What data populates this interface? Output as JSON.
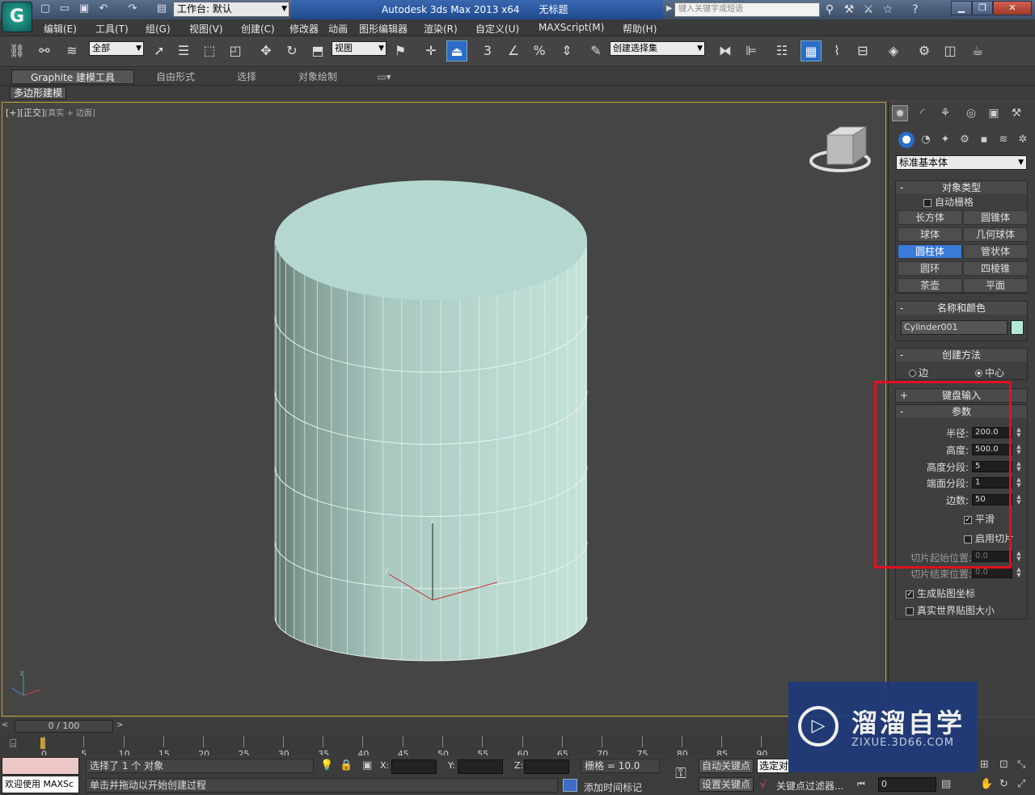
{
  "title_bar": {
    "logo_glyph": "G",
    "workspace_label": "工作台: 默认",
    "app_title": "Autodesk 3ds Max  2013 x64",
    "document_name": "无标题",
    "search_placeholder": "键入关键字或短语"
  },
  "menu": [
    "编辑(E)",
    "工具(T)",
    "组(G)",
    "视图(V)",
    "创建(C)",
    "修改器",
    "动画",
    "图形编辑器",
    "渲染(R)",
    "自定义(U)",
    "MAXScript(M)",
    "帮助(H)"
  ],
  "toolbar": {
    "selection_filter": "全部",
    "reference_coord": "视图",
    "named_selection": "创建选择集",
    "snap_label": "3",
    "percent_label": "%"
  },
  "ribbon": {
    "tabs": [
      "Graphite 建模工具",
      "自由形式",
      "选择",
      "对象绘制"
    ],
    "active_tab": "Graphite 建模工具",
    "sub_button": "多边形建模"
  },
  "viewport": {
    "label_plus": "[+]",
    "label_view": "[正交]",
    "label_shading": "[真实 + 边面]",
    "axis_x": "x",
    "axis_y": "y",
    "axis_z": "z",
    "object_color": "#b4d8d0"
  },
  "command_panel": {
    "category": "标准基本体",
    "object_type": {
      "title": "对象类型",
      "autogrid": "自动栅格",
      "buttons": [
        "长方体",
        "圆锥体",
        "球体",
        "几何球体",
        "圆柱体",
        "管状体",
        "圆环",
        "四棱锥",
        "茶壶",
        "平面"
      ],
      "active": "圆柱体"
    },
    "name_color": {
      "title": "名称和颜色",
      "name": "Cylinder001",
      "swatch": "#b4e8d8"
    },
    "creation_method": {
      "title": "创建方法",
      "options": [
        "边",
        "中心"
      ],
      "selected": "中心"
    },
    "keyboard_entry": {
      "title": "键盘输入"
    },
    "parameters": {
      "title": "参数",
      "radius_label": "半径:",
      "radius": "200.0",
      "height_label": "高度:",
      "height": "500.0",
      "height_segs_label": "高度分段:",
      "height_segs": "5",
      "cap_segs_label": "端面分段:",
      "cap_segs": "1",
      "sides_label": "边数:",
      "sides": "50",
      "smooth_label": "平滑",
      "slice_on_label": "启用切片",
      "slice_from_label": "切片起始位置:",
      "slice_from": "0.0",
      "slice_to_label": "切片结束位置:",
      "slice_to": "0.0",
      "gen_map_label": "生成贴图坐标",
      "real_world_label": "真实世界贴图大小"
    }
  },
  "timeline": {
    "frame": "0 / 100",
    "ticks": [
      "0",
      "5",
      "10",
      "15",
      "20",
      "25",
      "30",
      "35",
      "40",
      "45",
      "50",
      "55",
      "60",
      "65",
      "70",
      "75",
      "80",
      "85",
      "90"
    ]
  },
  "status": {
    "maxscript": "欢迎使用 MAXSc",
    "selected": "选择了 1 个 对象",
    "prompt": "单击并拖动以开始创建过程",
    "x_label": "X:",
    "y_label": "Y:",
    "z_label": "Z:",
    "grid": "栅格 = 10.0",
    "auto_key": "自动关键点",
    "set_key": "设置关键点",
    "selected_obj": "选定对",
    "add_time_tag": "添加时间标记",
    "key_filters": "关键点过滤器...",
    "frame_field": "0"
  },
  "watermark": {
    "title": "溜溜自学",
    "url": "ZIXUE.3D66.COM"
  }
}
